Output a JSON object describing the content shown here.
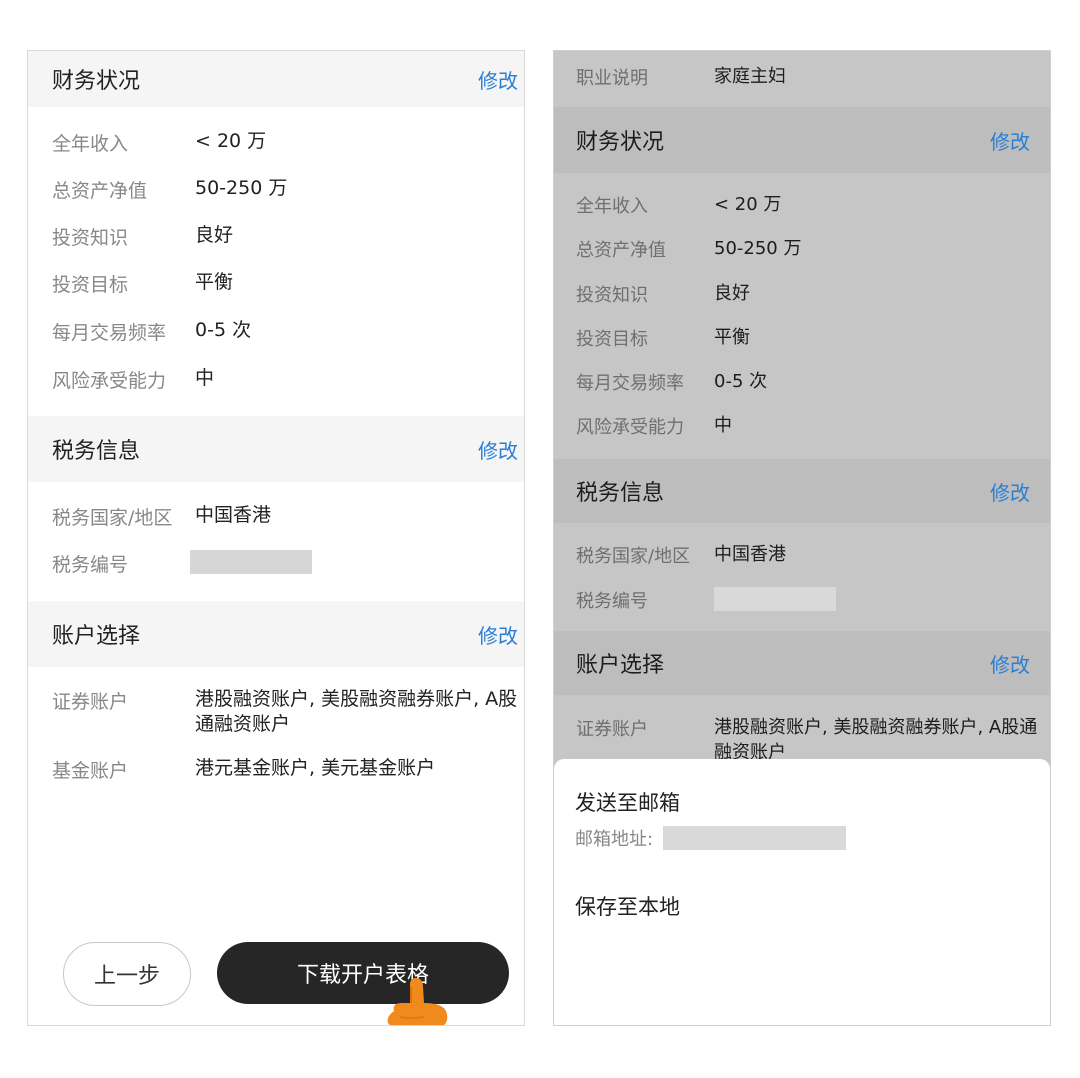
{
  "left": {
    "financial": {
      "title": "财务状况",
      "edit": "修改",
      "rows": [
        {
          "label": "全年收入",
          "value": "< 20 万"
        },
        {
          "label": "总资产净值",
          "value": "50-250 万"
        },
        {
          "label": "投资知识",
          "value": "良好"
        },
        {
          "label": "投资目标",
          "value": "平衡"
        },
        {
          "label": "每月交易频率",
          "value": "0-5 次"
        },
        {
          "label": "风险承受能力",
          "value": "中"
        }
      ]
    },
    "tax": {
      "title": "税务信息",
      "edit": "修改",
      "rows": [
        {
          "label": "税务国家/地区",
          "value": "中国香港"
        },
        {
          "label": "税务编号",
          "value": ""
        }
      ]
    },
    "account": {
      "title": "账户选择",
      "edit": "修改",
      "rows": [
        {
          "label": "证券账户",
          "value": "港股融资账户, 美股融资融券账户, A股通融资账户"
        },
        {
          "label": "基金账户",
          "value": "港元基金账户, 美元基金账户"
        }
      ]
    },
    "buttons": {
      "prev": "上一步",
      "download": "下载开户表格"
    }
  },
  "right": {
    "occupation": {
      "label": "职业说明",
      "value": "家庭主妇"
    },
    "financial": {
      "title": "财务状况",
      "edit": "修改",
      "rows": [
        {
          "label": "全年收入",
          "value": "< 20 万"
        },
        {
          "label": "总资产净值",
          "value": "50-250 万"
        },
        {
          "label": "投资知识",
          "value": "良好"
        },
        {
          "label": "投资目标",
          "value": "平衡"
        },
        {
          "label": "每月交易频率",
          "value": "0-5 次"
        },
        {
          "label": "风险承受能力",
          "value": "中"
        }
      ]
    },
    "tax": {
      "title": "税务信息",
      "edit": "修改",
      "rows": [
        {
          "label": "税务国家/地区",
          "value": "中国香港"
        },
        {
          "label": "税务编号",
          "value": ""
        }
      ]
    },
    "account": {
      "title": "账户选择",
      "edit": "修改",
      "rows": [
        {
          "label": "证券账户",
          "value": "港股融资账户, 美股融资融券账户, A股通融资账户"
        }
      ]
    },
    "sheet": {
      "send_email": "发送至邮箱",
      "email_label": "邮箱地址:",
      "save_local": "保存至本地"
    }
  },
  "colors": {
    "accent": "#2a7fd4",
    "primary_button": "#262626",
    "overlay": "#c6c6c6",
    "hand": "#f08a1c"
  },
  "icons": {
    "tap_hand": "pointing-hand-icon"
  }
}
